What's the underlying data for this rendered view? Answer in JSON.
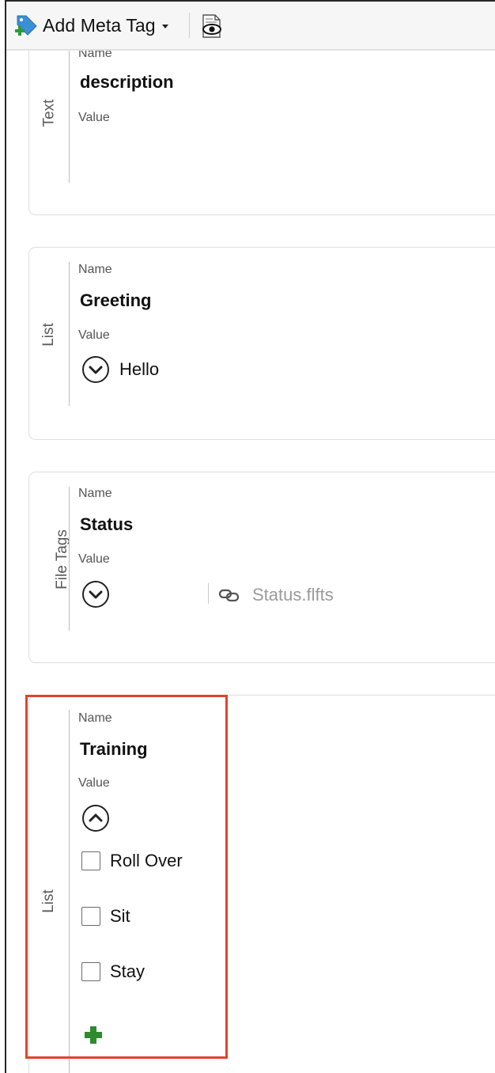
{
  "toolbar": {
    "add_meta_tag_label": "Add Meta Tag",
    "add_icon": "tag-add-icon",
    "preview_icon": "eye-document-icon"
  },
  "field_labels": {
    "name": "Name",
    "value": "Value"
  },
  "panels": [
    {
      "type": "Text",
      "name": "description",
      "value": ""
    },
    {
      "type": "List",
      "name": "Greeting",
      "value": "Hello",
      "control_icon": "chevron-down-circle-icon"
    },
    {
      "type": "File Tags",
      "name": "Status",
      "value": "",
      "control_icon": "chevron-down-circle-icon",
      "file_icon": "link-icon",
      "file_name": "Status.flfts"
    },
    {
      "type": "List",
      "name": "Training",
      "control_icon": "chevron-up-circle-icon",
      "options": [
        {
          "label": "Roll Over",
          "checked": false
        },
        {
          "label": "Sit",
          "checked": false
        },
        {
          "label": "Stay",
          "checked": false
        }
      ],
      "add_icon": "plus-icon",
      "highlighted": true
    }
  ],
  "colors": {
    "highlight_border": "#e0452c",
    "add_plus_green": "#2e8b2e",
    "tag_icon_blue": "#3a8fd9"
  }
}
